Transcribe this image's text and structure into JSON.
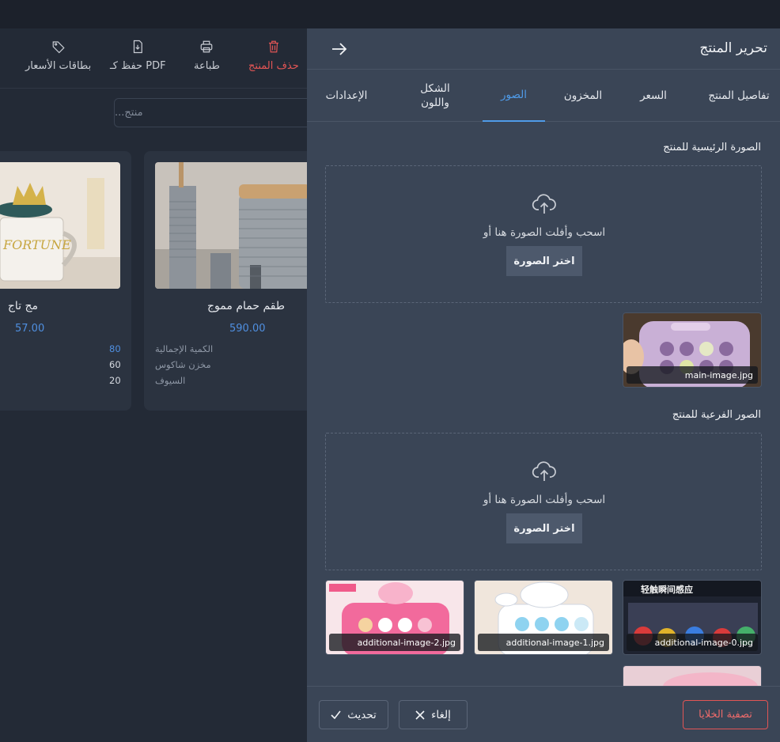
{
  "toolbar": {
    "price_cards_label": "بطاقات الأسعار",
    "save_pdf_label": "حفظ كـ PDF",
    "print_label": "طباعة",
    "delete_label": "حذف المنتج"
  },
  "search": {
    "placeholder": "منتج..."
  },
  "products": [
    {
      "title": "طقم حمام مموج",
      "price": "590.00",
      "stock_labels": [
        "الكمية الإجمالية",
        "مخزن شاكوس",
        "السيوف"
      ]
    },
    {
      "title": "مج تاج",
      "price": "57.00",
      "stock_values": [
        "80",
        "60",
        "20"
      ]
    }
  ],
  "panel": {
    "title": "تحرير المنتج",
    "tabs": [
      {
        "label": "تفاصيل المنتج",
        "active": false
      },
      {
        "label": "السعر",
        "active": false
      },
      {
        "label": "المخزون",
        "active": false
      },
      {
        "label": "الصور",
        "active": true
      },
      {
        "label": "الشكل واللون",
        "active": false
      },
      {
        "label": "الإعدادات",
        "active": false
      }
    ],
    "main_section": {
      "label": "الصورة الرئيسية للمنتج",
      "drop_text": "اسحب وأفلت الصورة هنا أو",
      "button": "اختر الصورة",
      "images": [
        "main-image.jpg"
      ]
    },
    "additional_section": {
      "label": "الصور الفرعية للمنتج",
      "drop_text": "اسحب وأفلت الصورة هنا أو",
      "button": "اختر الصورة",
      "images": [
        "additional-image-0.jpg",
        "additional-image-1.jpg",
        "additional-image-2.jpg"
      ]
    },
    "footer": {
      "reset_label": "تصفية الخلايا",
      "cancel_label": "إلغاء",
      "update_label": "تحديث"
    }
  },
  "colors": {
    "accent": "#4f9be8",
    "danger": "#e25555",
    "price": "#4f8fe0",
    "panel_bg": "#3a4556",
    "page_bg": "#232a36"
  }
}
